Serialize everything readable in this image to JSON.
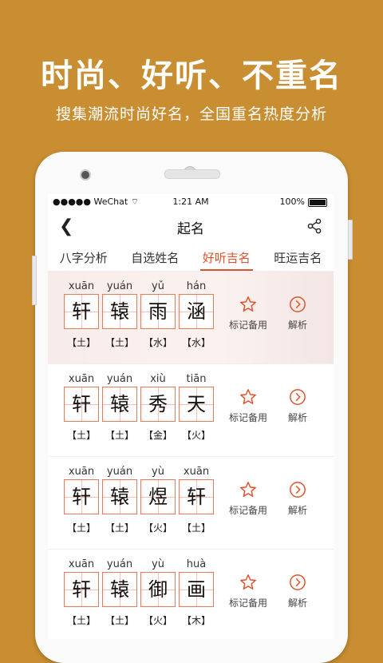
{
  "headline": "时尚、好听、不重名",
  "subline": "搜集潮流时尚好名，全国重名热度分析",
  "status": {
    "carrier": "WeChat",
    "time": "1:21 AM",
    "battery": "100%"
  },
  "nav": {
    "title": "起名"
  },
  "tabs": [
    {
      "label": "八字分析"
    },
    {
      "label": "自选姓名"
    },
    {
      "label": "好听吉名"
    },
    {
      "label": "旺运吉名"
    }
  ],
  "actions": {
    "mark": "标记备用",
    "analyze": "解析"
  },
  "names": [
    {
      "chars": [
        {
          "py": "xuān",
          "ch": "轩",
          "el": "【土】"
        },
        {
          "py": "yuán",
          "ch": "辕",
          "el": "【土】"
        },
        {
          "py": "yǔ",
          "ch": "雨",
          "el": "【水】"
        },
        {
          "py": "hán",
          "ch": "涵",
          "el": "【水】"
        }
      ]
    },
    {
      "chars": [
        {
          "py": "xuān",
          "ch": "轩",
          "el": "【土】"
        },
        {
          "py": "yuán",
          "ch": "辕",
          "el": "【土】"
        },
        {
          "py": "xiù",
          "ch": "秀",
          "el": "【金】"
        },
        {
          "py": "tiān",
          "ch": "天",
          "el": "【火】"
        }
      ]
    },
    {
      "chars": [
        {
          "py": "xuān",
          "ch": "轩",
          "el": "【土】"
        },
        {
          "py": "yuán",
          "ch": "辕",
          "el": "【土】"
        },
        {
          "py": "yù",
          "ch": "煜",
          "el": "【火】"
        },
        {
          "py": "xuān",
          "ch": "轩",
          "el": "【土】"
        }
      ]
    },
    {
      "chars": [
        {
          "py": "xuān",
          "ch": "轩",
          "el": "【土】"
        },
        {
          "py": "yuán",
          "ch": "辕",
          "el": "【土】"
        },
        {
          "py": "yù",
          "ch": "御",
          "el": "【火】"
        },
        {
          "py": "huà",
          "ch": "画",
          "el": "【木】"
        }
      ]
    }
  ],
  "colors": {
    "background": "#c98e31",
    "accent": "#e0522b"
  }
}
